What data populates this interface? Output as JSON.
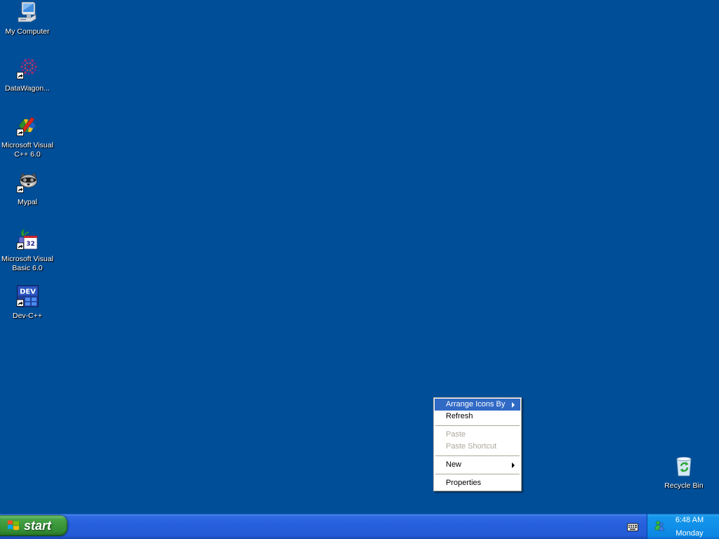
{
  "desktop": {
    "background_color": "#004E98",
    "icons": [
      {
        "label": "My Computer",
        "icon": "my-computer-icon",
        "shortcut": false
      },
      {
        "label": "DataWagon...",
        "icon": "datawagon-icon",
        "shortcut": true
      },
      {
        "label": "Microsoft Visual C++ 6.0",
        "icon": "visual-cpp-icon",
        "shortcut": true
      },
      {
        "label": "Mypal",
        "icon": "mypal-raccoon-icon",
        "shortcut": true
      },
      {
        "label": "Microsoft Visual Basic 6.0",
        "icon": "visual-basic-icon",
        "shortcut": true,
        "icon_text": "32"
      },
      {
        "label": "Dev-C++",
        "icon": "dev-cpp-icon",
        "shortcut": true,
        "icon_text": "DEV"
      }
    ],
    "recycle_bin": {
      "label": "Recycle Bin",
      "icon": "recycle-bin-icon"
    }
  },
  "context_menu": {
    "highlight_color": "#316AC5",
    "disabled_color": "#ACA899",
    "items": [
      {
        "label": "Arrange Icons By",
        "submenu": true,
        "highlighted": true,
        "disabled": false
      },
      {
        "label": "Refresh",
        "submenu": false,
        "highlighted": false,
        "disabled": false
      },
      {
        "label": "Paste",
        "submenu": false,
        "highlighted": false,
        "disabled": true
      },
      {
        "label": "Paste Shortcut",
        "submenu": false,
        "highlighted": false,
        "disabled": true
      },
      {
        "label": "New",
        "submenu": true,
        "highlighted": false,
        "disabled": false
      },
      {
        "label": "Properties",
        "submenu": false,
        "highlighted": false,
        "disabled": false
      }
    ]
  },
  "taskbar": {
    "start_label": "start",
    "start_icon": "windows-logo-icon",
    "tray_icons": [
      "keyboard-icon",
      "tray-app-icon"
    ],
    "clock": {
      "time": "6:48 AM",
      "day": "Monday"
    },
    "colors": {
      "taskbar": "#245EDC",
      "start_button": "#3C9A3C",
      "tray": "#1090E8"
    }
  }
}
